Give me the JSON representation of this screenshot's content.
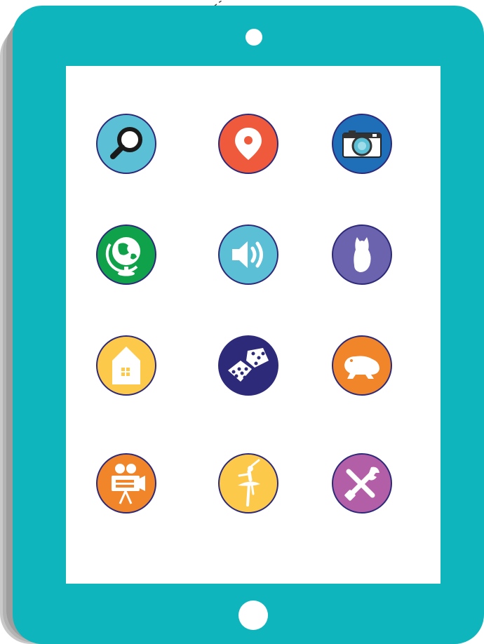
{
  "device": {
    "type": "tablet",
    "frame_color": "#0fb5bc",
    "screen_color": "#ffffff"
  },
  "apps": [
    {
      "icon": "search-icon",
      "color": "#5bc0d6"
    },
    {
      "icon": "location-pin-icon",
      "color": "#ef5a3c"
    },
    {
      "icon": "camera-icon",
      "color": "#1f6fb8"
    },
    {
      "icon": "globe-icon",
      "color": "#10a24a"
    },
    {
      "icon": "speaker-icon",
      "color": "#5bc0d6"
    },
    {
      "icon": "owl-icon",
      "color": "#6b63ad"
    },
    {
      "icon": "house-icon",
      "color": "#fdc94a"
    },
    {
      "icon": "dice-icon",
      "color": "#2e2a7a"
    },
    {
      "icon": "frog-icon",
      "color": "#f0852a"
    },
    {
      "icon": "film-projector-icon",
      "color": "#f0852a"
    },
    {
      "icon": "ballerina-icon",
      "color": "#fdc94a"
    },
    {
      "icon": "tools-icon",
      "color": "#b35fa7"
    }
  ]
}
